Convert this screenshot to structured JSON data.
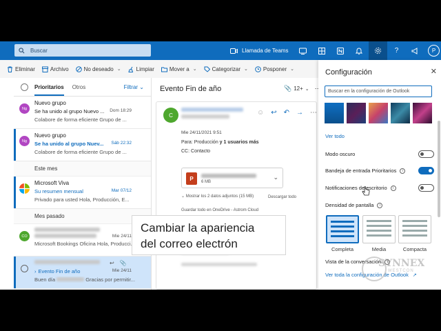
{
  "topbar": {
    "search_placeholder": "Buscar",
    "teams_call": "Llamada de Teams",
    "avatar_initial": "P",
    "accent": "#0f6cbd"
  },
  "toolbar": {
    "delete": "Eliminar",
    "archive": "Archivo",
    "junk": "No deseado",
    "sweep": "Limpiar",
    "move": "Mover a",
    "categorize": "Categorizar",
    "snooze": "Posponer"
  },
  "list": {
    "tab_focused": "Prioritarios",
    "tab_other": "Otros",
    "filter": "Filtrar",
    "mails": [
      {
        "avatar": "Ng",
        "avatar_color": "#b146c2",
        "sender": "Nuevo grupo",
        "subject": "Se ha unido al grupo Nuevo ...",
        "date": "Dom 18:29",
        "preview": "Colabore de forma eficiente Grupo de ...",
        "unread": false
      },
      {
        "avatar": "Ng",
        "avatar_color": "#b146c2",
        "sender": "Nuevo grupo",
        "subject": "Se ha unido al grupo Nuev...",
        "date": "Sáb 22:32",
        "preview": "Colabore de forma eficiente Grupo de ...",
        "unread": true
      }
    ],
    "section_month": "Este mes",
    "viva": {
      "sender": "Microsoft Viva",
      "subject": "Su resumen mensual",
      "date": "Mar 07/12",
      "preview": "Privado para usted Hola, Producción, E..."
    },
    "section_last": "Mes pasado",
    "bookings": {
      "avatar": "CO",
      "avatar_color": "#4ea72e",
      "date": "Mie 24/11",
      "preview": "Microsoft Bookings Oficina Hola, Producci..."
    },
    "selected": {
      "subject": "Evento Fin de año",
      "date": "Mie 24/11",
      "preview_start": "Buen día",
      "preview_end": "Gracias por permitir..."
    }
  },
  "reading": {
    "title": "Evento Fin de año",
    "count": "12+",
    "sender_initial": "C",
    "date": "Mie 24/11/2021 9:51",
    "to_label": "Para:",
    "to_value": "Producción",
    "to_more": "y 1 usuarios más",
    "cc_label": "CC:",
    "cc_value": "Contacto",
    "attach_size": "6 MB",
    "attach_summary": "Mostrar los 2 datos adjuntos (15 MB)",
    "download_all": "Descargar todo",
    "save_onedrive": "Guardar todo en OneDrive - Astrom Cloud"
  },
  "settings": {
    "title": "Configuración",
    "search_placeholder": "Buscar en la configuración de Outlook",
    "see_all": "Ver todo",
    "dark_mode": "Modo oscuro",
    "focused_inbox": "Bandeja de entrada Prioritarios",
    "desktop_notifications": "Notificaciones de escritorio",
    "density_title": "Densidad de pantalla",
    "density_full": "Completa",
    "density_medium": "Media",
    "density_compact": "Compacta",
    "conversation_view": "Vista de la conversación",
    "see_all_outlook": "Ver toda la configuración de Outlook"
  },
  "caption": {
    "line1": "Cambiar la apariencia",
    "line2": "del correo electrón"
  },
  "watermark": {
    "line1": "SYNNEX",
    "line2": "WESTCON"
  }
}
